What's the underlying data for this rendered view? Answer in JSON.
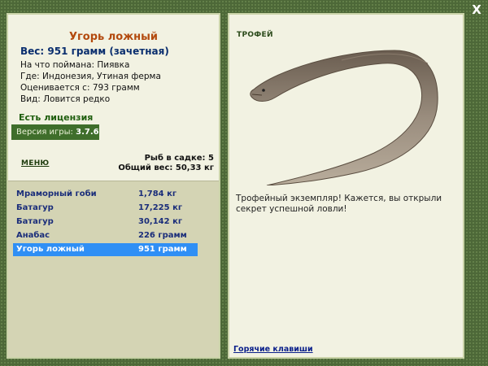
{
  "close_label": "X",
  "fish": {
    "title": "Угорь ложный",
    "weight": "Вес: 951 грамм (зачетная)",
    "bait": "На что поймана: Пиявка",
    "location": "Где: Индонезия, Утиная ферма",
    "value": "Оценивается с: 793 грамм",
    "kind": "Вид: Ловится редко"
  },
  "license": "Есть лицензия",
  "version": {
    "label": "Версия игры:",
    "value": "3.7.6"
  },
  "menu_label": "МЕНЮ",
  "stats": {
    "in_cage": "Рыб в садке: 5",
    "total_weight": "Общий вес: 50,33 кг"
  },
  "catches": [
    {
      "name": "Мраморный гоби",
      "weight": "1,784 кг"
    },
    {
      "name": "Батагур",
      "weight": "17,225 кг"
    },
    {
      "name": "Батагур",
      "weight": "30,142 кг"
    },
    {
      "name": "Анабас",
      "weight": "226 грамм"
    },
    {
      "name": "Угорь ложный",
      "weight": "951 грамм",
      "selected": true
    }
  ],
  "trophy": {
    "label": "ТРОФЕЙ",
    "text": "Трофейный экземпляр! Кажется, вы открыли секрет успешной ловли!",
    "image_icon": "eel-image"
  },
  "hotkeys_label": "Горячие клавиши",
  "colors": {
    "background": "#4d6838",
    "panel": "#f2f2e2",
    "title": "#b34a0e",
    "selected_row": "#2f8ff5",
    "version_bar": "#3f6e2b"
  }
}
